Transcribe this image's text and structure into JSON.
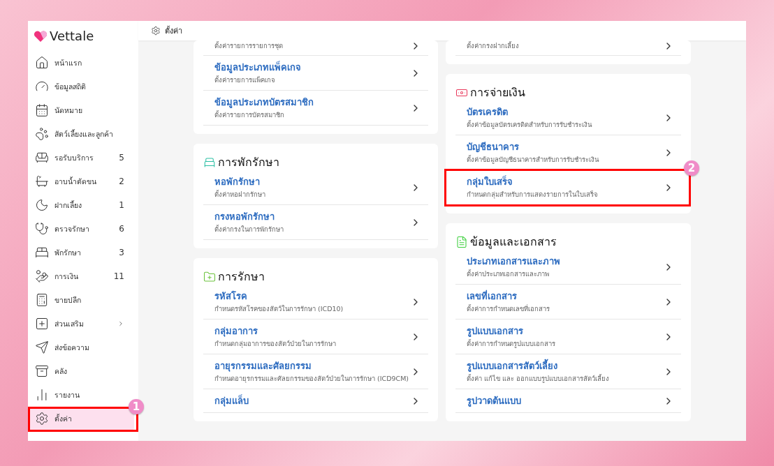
{
  "brand": "Vettale",
  "topbar": {
    "title": "ตั้งค่า"
  },
  "sidebar": {
    "items": [
      {
        "label": "หน้าแรก",
        "selected": false
      },
      {
        "label": "ข้อมูลสถิติ",
        "selected": false
      },
      {
        "label": "นัดหมาย",
        "selected": false
      },
      {
        "label": "สัตว์เลี้ยงและลูกค้า",
        "selected": false
      },
      {
        "label": "รอรับบริการ",
        "count": "5",
        "selected": false
      },
      {
        "label": "อาบน้ำตัดขน",
        "count": "2",
        "selected": false
      },
      {
        "label": "ฝากเลี้ยง",
        "count": "1",
        "selected": false
      },
      {
        "label": "ตรวจรักษา",
        "count": "6",
        "selected": false
      },
      {
        "label": "พักรักษา",
        "count": "3",
        "selected": false
      },
      {
        "label": "การเงิน",
        "count": "11",
        "selected": false
      },
      {
        "label": "ขายปลีก",
        "selected": false
      },
      {
        "label": "ส่วนเสริม",
        "expanded": false,
        "selected": false
      },
      {
        "label": "ส่งข้อความ",
        "selected": false
      },
      {
        "label": "คลัง",
        "selected": false
      },
      {
        "label": "รายงาน",
        "selected": false
      },
      {
        "label": "ตั้งค่า",
        "selected": true,
        "callout": "1"
      }
    ]
  },
  "columns": [
    {
      "sections": [
        {
          "kind": "plain",
          "items": [
            {
              "subtitle": "ตั้งค่ารายการรายการชุด"
            },
            {
              "title": "ข้อมูลประเภทแพ็คเกจ",
              "subtitle": "ตั้งค่ารายการแพ็คเกจ"
            },
            {
              "title": "ข้อมูลประเภทบัตรสมาชิก",
              "subtitle": "ตั้งค่ารายการบัตรสมาชิก"
            }
          ]
        },
        {
          "kind": "bed",
          "title": "การพักรักษา",
          "items": [
            {
              "title": "หอพักรักษา",
              "subtitle": "ตั้งค่าหอฝากรักษา"
            },
            {
              "title": "กรงหอพักรักษา",
              "subtitle": "ตั้งค่ากรงในการพักรักษา"
            }
          ]
        },
        {
          "kind": "treatment",
          "title": "การรักษา",
          "items": [
            {
              "title": "รหัสโรค",
              "subtitle": "กำหนดรหัสโรคของสัตว์ในการรักษา (ICD10)"
            },
            {
              "title": "กลุ่มอาการ",
              "subtitle": "กำหนดกลุ่มอาการของสัตว์ป่วยในการรักษา"
            },
            {
              "title": "อายุรกรรมและศัลยกรรม",
              "subtitle": "กำหนดอายุรกรรมและศัลยกรรมของสัตว์ป่วยในการรักษา (ICD9CM)"
            },
            {
              "title": "กลุ่มแล็บ"
            }
          ]
        }
      ]
    },
    {
      "sections": [
        {
          "kind": "plain",
          "items": [
            {
              "subtitle": "ตั้งค่ากรงฝากเลี้ยง"
            }
          ]
        },
        {
          "kind": "payment",
          "title": "การจ่ายเงิน",
          "items": [
            {
              "title": "บัตรเครดิต",
              "subtitle": "ตั้งค่าข้อมูลบัตรเครดิตสำหรับการรับชำระเงิน"
            },
            {
              "title": "บัญชีธนาคาร",
              "subtitle": "ตั้งค่าข้อมูลบัญชีธนาคารสำหรับการรับชำระเงิน"
            },
            {
              "title": "กลุ่มใบเสร็จ",
              "subtitle": "กำหนดกลุ่มสำหรับการแสดงรายการในใบเสร็จ",
              "callout": "2"
            }
          ]
        },
        {
          "kind": "document",
          "title": "ข้อมูลและเอกสาร",
          "items": [
            {
              "title": "ประเภทเอกสารและภาพ",
              "subtitle": "ตั้งค่าประเภทเอกสารและภาพ"
            },
            {
              "title": "เลขที่เอกสาร",
              "subtitle": "ตั้งค่าการกำหนดเลขที่เอกสาร"
            },
            {
              "title": "รูปแบบเอกสาร",
              "subtitle": "ตั้งค่าการกำหนดรูปแบบเอกสาร"
            },
            {
              "title": "รูปแบบเอกสารสัตว์เลี้ยง",
              "subtitle": "ตั้งค่า แก้ไข และ ออกแบบรูปแบบเอกสารสัตว์เลี้ยง"
            },
            {
              "title": "รูปวาดต้นแบบ"
            }
          ]
        }
      ]
    }
  ]
}
